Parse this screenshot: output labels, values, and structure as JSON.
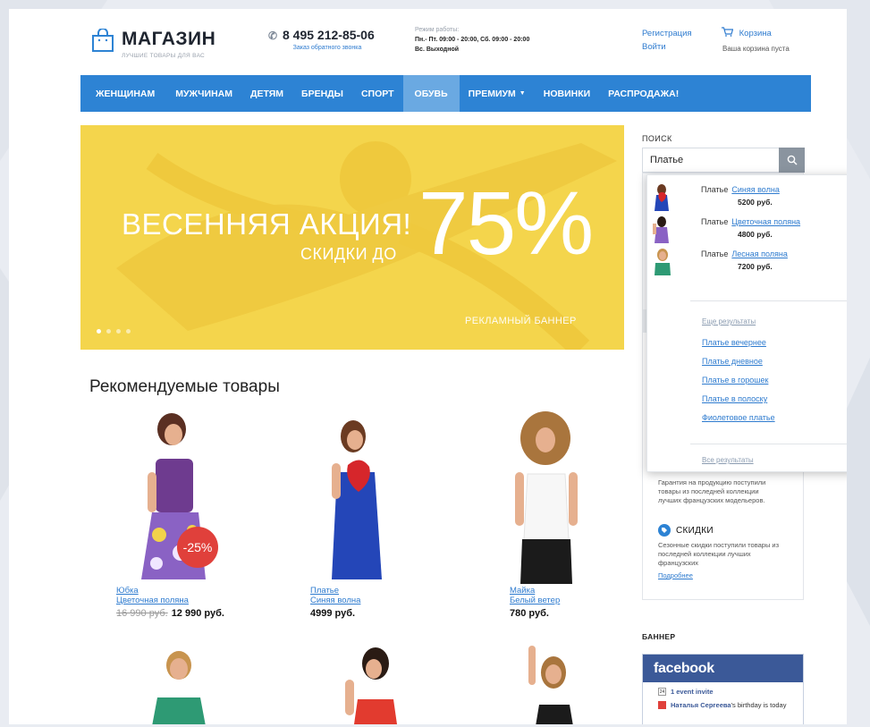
{
  "header": {
    "logo_name": "МАГАЗИН",
    "logo_tagline": "ЛУЧШИЕ ТОВАРЫ ДЛЯ ВАС",
    "phone": "8 495 212-85-06",
    "callback_link": "Заказ обратного звонка",
    "hours_label": "Режим работы:",
    "hours_weekdays": "Пн.- Пт. 09:00 - 20:00, Сб. 09:00 - 20:00",
    "hours_sunday": "Вс. Выходной",
    "register_link": "Регистрация",
    "login_link": "Войти",
    "cart_link": "Корзина",
    "cart_status": "Ваша корзина пуста"
  },
  "nav": {
    "items": [
      {
        "label": "ЖЕНЩИНАМ"
      },
      {
        "label": "МУЖЧИНАМ"
      },
      {
        "label": "ДЕТЯМ"
      },
      {
        "label": "БРЕНДЫ"
      },
      {
        "label": "СПОРТ"
      },
      {
        "label": "ОБУВЬ"
      },
      {
        "label": "ПРЕМИУМ"
      },
      {
        "label": "НОВИНКИ"
      },
      {
        "label": "РАСПРОДАЖА!"
      }
    ],
    "active_index": 5
  },
  "hero": {
    "headline": "ВЕСЕННЯЯ АКЦИЯ!",
    "subline": "СКИДКИ ДО",
    "percent": "75%",
    "caption": "РЕКЛАМНЫЙ БАННЕР",
    "slides_count": 4,
    "active_slide": 0,
    "bg_color": "#f4d54c"
  },
  "featured": {
    "title": "Рекомендуемые товары",
    "products": [
      {
        "category": "Юбка",
        "name": "Цветочная поляна",
        "old_price": "16 990 руб.",
        "price": "12 990 руб.",
        "badge": "-25%"
      },
      {
        "category": "Платье",
        "name": "Синяя волна",
        "old_price": "",
        "price": "4999 руб.",
        "badge": ""
      },
      {
        "category": "Майка",
        "name": "Белый ветер",
        "old_price": "",
        "price": "780 руб.",
        "badge": ""
      }
    ]
  },
  "search": {
    "label": "ПОИСК",
    "value": "Платье",
    "results": [
      {
        "type": "Платье",
        "name": "Синяя волна",
        "price": "5200 руб."
      },
      {
        "type": "Платье",
        "name": "Цветочная поляна",
        "price": "4800 руб."
      },
      {
        "type": "Платье",
        "name": "Лесная поляна",
        "price": "7200 руб."
      }
    ],
    "more_results": "Еще результаты",
    "suggestions": [
      "Платье вечернее",
      "Платье дневное",
      "Платье в горошек",
      "Платье в полоску",
      "Фиолетовое платье"
    ],
    "all_results": "Все результаты"
  },
  "sidebar": {
    "guarantee_text": "Гарантия на продукцию поступили товары из последней коллекции лучших французских модельеров.",
    "discounts_title": "СКИДКИ",
    "discounts_text": "Сезонные скидки поступили товары из последней коллекции лучших французских",
    "discounts_more": "Подробнее",
    "banner_label": "БАННЕР"
  },
  "facebook": {
    "title": "facebook",
    "event": "1 event invite",
    "birthday_name": "Наталья Сергеева",
    "birthday_text": "'s birthday is today",
    "cal_day": "24"
  },
  "colors": {
    "nav_blue": "#2d83d4",
    "nav_active": "#6aa9e2",
    "link": "#2e7bcf",
    "sale": "#e0403b",
    "fb_blue": "#3b5998"
  }
}
